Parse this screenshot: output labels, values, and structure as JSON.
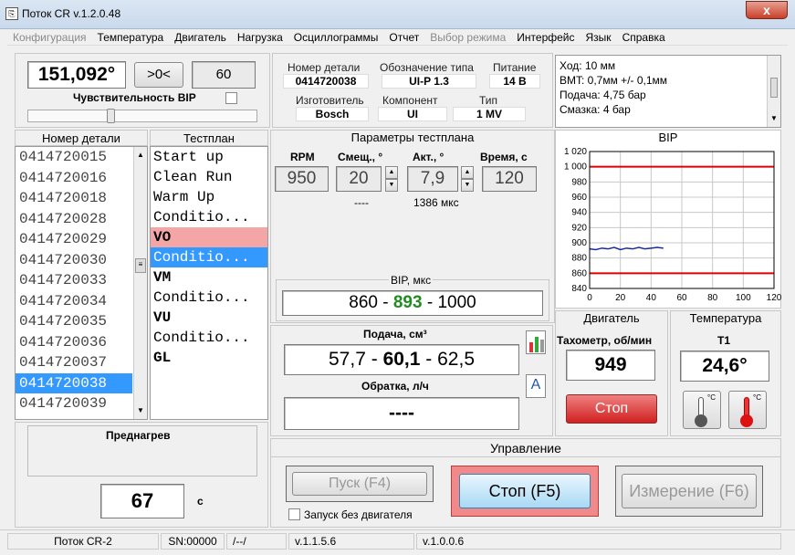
{
  "window": {
    "title": "Поток CR v.1.2.0.48",
    "close": "x"
  },
  "menu": [
    {
      "label": "Конфигурация",
      "disabled": true
    },
    {
      "label": "Температура",
      "disabled": false
    },
    {
      "label": "Двигатель",
      "disabled": false
    },
    {
      "label": "Нагрузка",
      "disabled": false
    },
    {
      "label": "Осциллограммы",
      "disabled": false
    },
    {
      "label": "Отчет",
      "disabled": false
    },
    {
      "label": "Выбор режима",
      "disabled": true
    },
    {
      "label": "Интерфейс",
      "disabled": false
    },
    {
      "label": "Язык",
      "disabled": false
    },
    {
      "label": "Справка",
      "disabled": false
    }
  ],
  "angle": {
    "value": "151,092°",
    "zero_btn": ">0<",
    "count": "60",
    "sensitivity_label": "Чувствительность BIP"
  },
  "part_info": {
    "number_label": "Номер детали",
    "number": "0414720038",
    "type_label": "Обозначение типа",
    "type": "UI-P 1.3",
    "power_label": "Питание",
    "power": "14 В",
    "maker_label": "Изготовитель",
    "maker": "Bosch",
    "component_label": "Компонент",
    "component": "UI",
    "kind_label": "Тип",
    "kind": "1 MV"
  },
  "notes": [
    "Ход: 10 мм",
    "BMT: 0,7мм +/- 0,1мм",
    "Подача: 4,75 бар",
    "Смазка: 4 бар"
  ],
  "parts": {
    "header": "Номер детали",
    "items": [
      "0414720015",
      "0414720016",
      "0414720018",
      "0414720028",
      "0414720029",
      "0414720030",
      "0414720033",
      "0414720034",
      "0414720035",
      "0414720036",
      "0414720037",
      "0414720038",
      "0414720039"
    ],
    "selected_index": 11
  },
  "testplan": {
    "header": "Тестплан",
    "items": [
      {
        "label": "Start up",
        "style": ""
      },
      {
        "label": "Clean Run",
        "style": ""
      },
      {
        "label": "Warm Up",
        "style": ""
      },
      {
        "label": "Conditio...",
        "style": ""
      },
      {
        "label": "VO",
        "style": "b pink"
      },
      {
        "label": "Conditio...",
        "style": "sel"
      },
      {
        "label": "VM",
        "style": "b"
      },
      {
        "label": "Conditio...",
        "style": ""
      },
      {
        "label": "VU",
        "style": "b"
      },
      {
        "label": "Conditio...",
        "style": ""
      },
      {
        "label": "GL",
        "style": "b"
      }
    ]
  },
  "params": {
    "header": "Параметры тестплана",
    "rpm_label": "RPM",
    "rpm": "950",
    "offset_label": "Смещ., °",
    "offset": "20",
    "offset_sub": "----",
    "act_label": "Акт., °",
    "act": "7,9",
    "act_sub": "1386 мкс",
    "time_label": "Время, с",
    "time": "120",
    "bip_label": "BIP, мкс",
    "bip_min": "860",
    "bip_val": "893",
    "bip_max": "1000",
    "dash": "-"
  },
  "feed": {
    "label": "Подача, см³",
    "min": "57,7",
    "val": "60,1",
    "max": "62,5",
    "return_label": "Обратка, л/ч",
    "return_val": "----"
  },
  "preheat": {
    "label": "Преднагрев",
    "value": "67",
    "unit": "с"
  },
  "engine": {
    "header": "Двигатель",
    "tach_label": "Тахометр, об/мин",
    "tach": "949",
    "stop": "Стоп"
  },
  "temperature": {
    "header": "Температура",
    "t1_label": "T1",
    "t1": "24,6°",
    "icon_unit": "°C"
  },
  "control": {
    "header": "Управление",
    "start": "Пуск (F4)",
    "stop": "Стоп (F5)",
    "measure": "Измерение (F6)",
    "no_engine": "Запуск без двигателя"
  },
  "status": {
    "name": "Поток CR-2",
    "sn": "SN:00000",
    "slash": "/--/",
    "v1": "v.1.1.5.6",
    "v2": "v.1.0.0.6"
  },
  "chart_data": {
    "type": "line",
    "title": "BIP",
    "xlim": [
      0,
      120
    ],
    "ylim": [
      840,
      1020
    ],
    "x_ticks": [
      0,
      20,
      40,
      60,
      80,
      100,
      120
    ],
    "y_ticks": [
      840,
      860,
      880,
      900,
      920,
      940,
      960,
      980,
      1000,
      1020
    ],
    "y_tick_labels": [
      "840",
      "860",
      "880",
      "900",
      "920",
      "940",
      "960",
      "980",
      "1 000",
      "1 020"
    ],
    "limits": [
      {
        "value": 1000,
        "color": "#dd0000"
      },
      {
        "value": 860,
        "color": "#dd0000"
      }
    ],
    "series": [
      {
        "color": "#1a2aa0",
        "x": [
          0,
          4,
          8,
          12,
          16,
          20,
          24,
          28,
          32,
          36,
          40,
          44,
          48
        ],
        "y": [
          892,
          891,
          893,
          892,
          894,
          891,
          893,
          892,
          894,
          892,
          893,
          894,
          893
        ]
      }
    ]
  }
}
